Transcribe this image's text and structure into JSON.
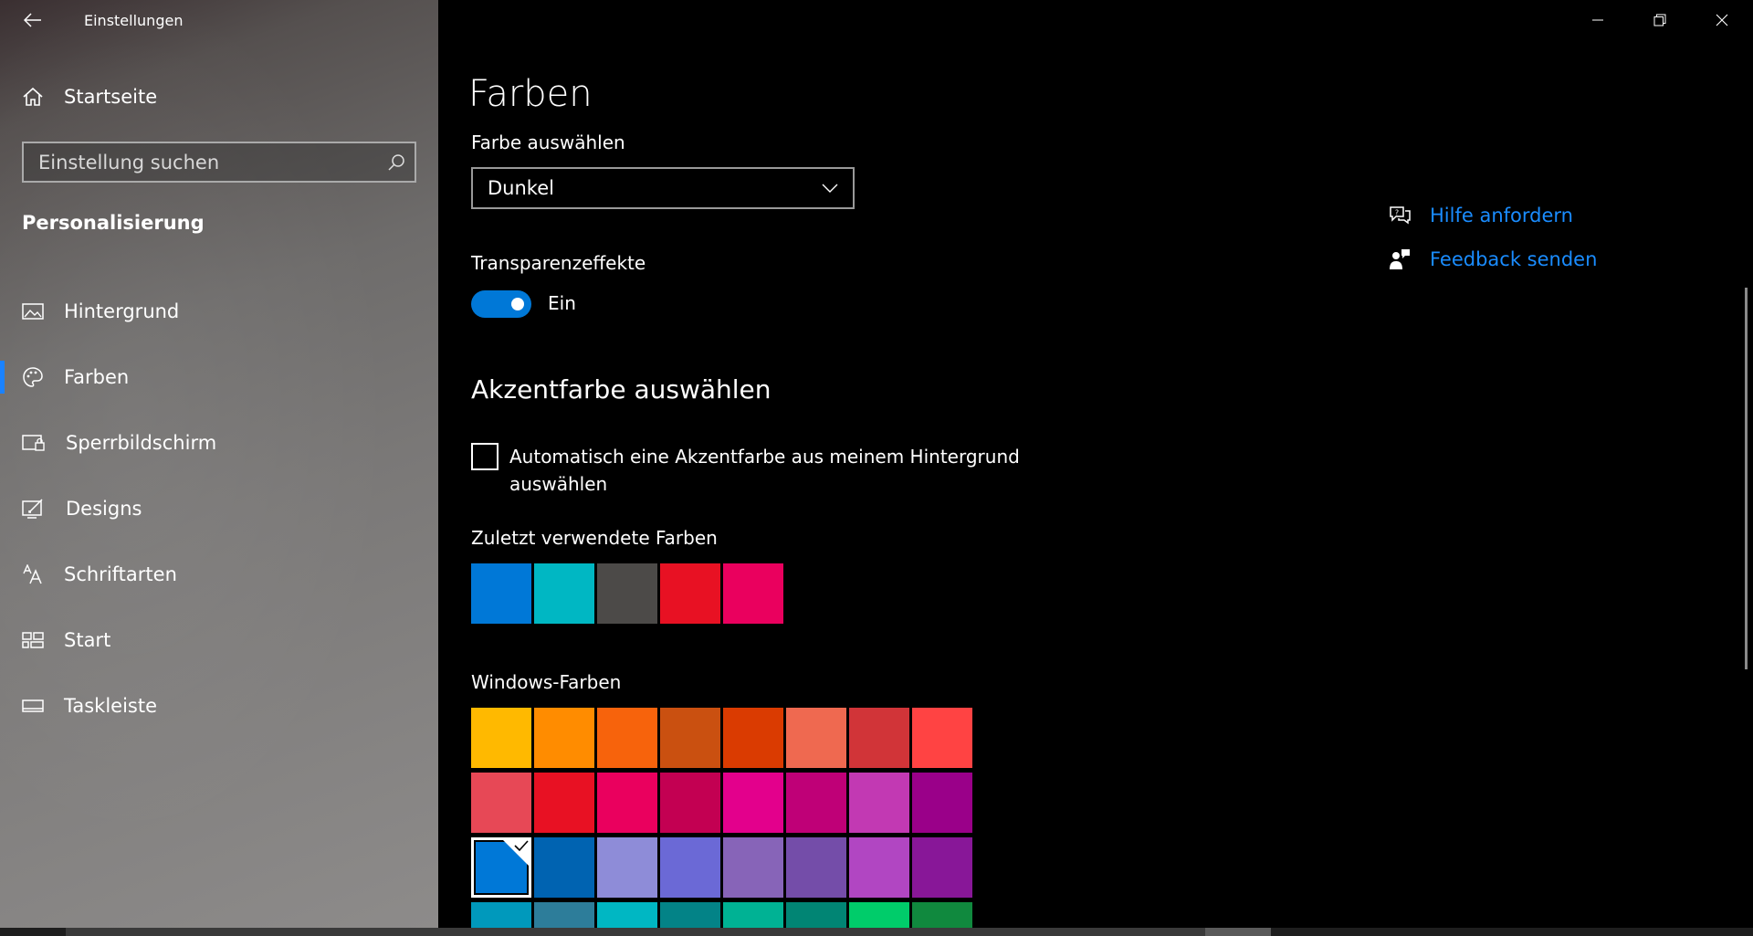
{
  "window": {
    "title": "Einstellungen"
  },
  "sidebar": {
    "home_label": "Startseite",
    "search_placeholder": "Einstellung suchen",
    "section_title": "Personalisierung",
    "items": [
      {
        "label": "Hintergrund",
        "icon": "picture-icon",
        "active": false
      },
      {
        "label": "Farben",
        "icon": "palette-icon",
        "active": true
      },
      {
        "label": "Sperrbildschirm",
        "icon": "lock-screen-icon",
        "active": false
      },
      {
        "label": "Designs",
        "icon": "designs-icon",
        "active": false
      },
      {
        "label": "Schriftarten",
        "icon": "fonts-icon",
        "active": false
      },
      {
        "label": "Start",
        "icon": "start-icon",
        "active": false
      },
      {
        "label": "Taskleiste",
        "icon": "taskbar-icon",
        "active": false
      }
    ]
  },
  "main": {
    "title": "Farben",
    "color_mode": {
      "label": "Farbe auswählen",
      "value": "Dunkel"
    },
    "transparency": {
      "label": "Transparenzeffekte",
      "state": "Ein"
    },
    "accent": {
      "heading": "Akzentfarbe auswählen",
      "auto_checkbox_label": "Automatisch eine Akzentfarbe aus meinem Hintergrund auswählen",
      "recent_label": "Zuletzt verwendete Farben",
      "recent_colors": [
        "#0078d7",
        "#00b7c3",
        "#4c4a48",
        "#e81123",
        "#ea005e"
      ],
      "windows_label": "Windows-Farben",
      "windows_colors": [
        [
          "#ffb900",
          "#ff8c00",
          "#f7630c",
          "#ca5010",
          "#da3b01",
          "#ef6950",
          "#d13438",
          "#ff4343"
        ],
        [
          "#e74856",
          "#e81123",
          "#ea005e",
          "#c30052",
          "#e3008c",
          "#bf0077",
          "#c239b3",
          "#9a0089"
        ],
        [
          "#0078d7",
          "#0063b1",
          "#8e8cd8",
          "#6b69d6",
          "#8764b8",
          "#744da9",
          "#b146c2",
          "#881798"
        ],
        [
          "#0099bc",
          "#2d7d9a",
          "#00b7c3",
          "#038387",
          "#00b294",
          "#018574",
          "#00cc6a",
          "#10893e"
        ]
      ],
      "selected_color": "#0078d7"
    },
    "help": {
      "help_label": "Hilfe anfordern",
      "feedback_label": "Feedback senden",
      "link_color": "#1a8cff"
    }
  },
  "colors": {
    "accent": "#0078d7",
    "background": "#000000"
  }
}
